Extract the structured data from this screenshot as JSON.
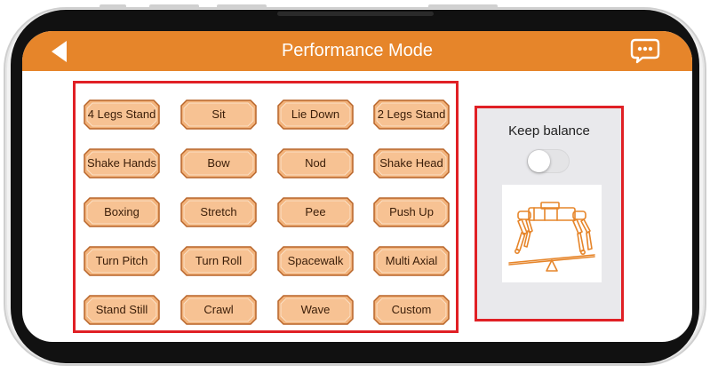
{
  "header": {
    "title": "Performance Mode",
    "back_icon": "back-arrow-icon",
    "chat_icon": "chat-bubble-icon"
  },
  "actions": [
    {
      "label": "4 Legs Stand"
    },
    {
      "label": "Sit"
    },
    {
      "label": "Lie Down"
    },
    {
      "label": "2 Legs Stand"
    },
    {
      "label": "Shake Hands"
    },
    {
      "label": "Bow"
    },
    {
      "label": "Nod"
    },
    {
      "label": "Shake Head"
    },
    {
      "label": "Boxing"
    },
    {
      "label": "Stretch"
    },
    {
      "label": "Pee"
    },
    {
      "label": "Push Up"
    },
    {
      "label": "Turn Pitch"
    },
    {
      "label": "Turn Roll"
    },
    {
      "label": "Spacewalk"
    },
    {
      "label": "Multi Axial"
    },
    {
      "label": "Stand Still"
    },
    {
      "label": "Crawl"
    },
    {
      "label": "Wave"
    },
    {
      "label": "Custom"
    }
  ],
  "balance": {
    "label": "Keep balance",
    "enabled": false,
    "image_icon": "robot-dog-balance-icon"
  },
  "colors": {
    "accent": "#e6852a",
    "highlight_border": "#e02025",
    "button_fill": "#f2b27a",
    "button_border": "#b8652a"
  }
}
